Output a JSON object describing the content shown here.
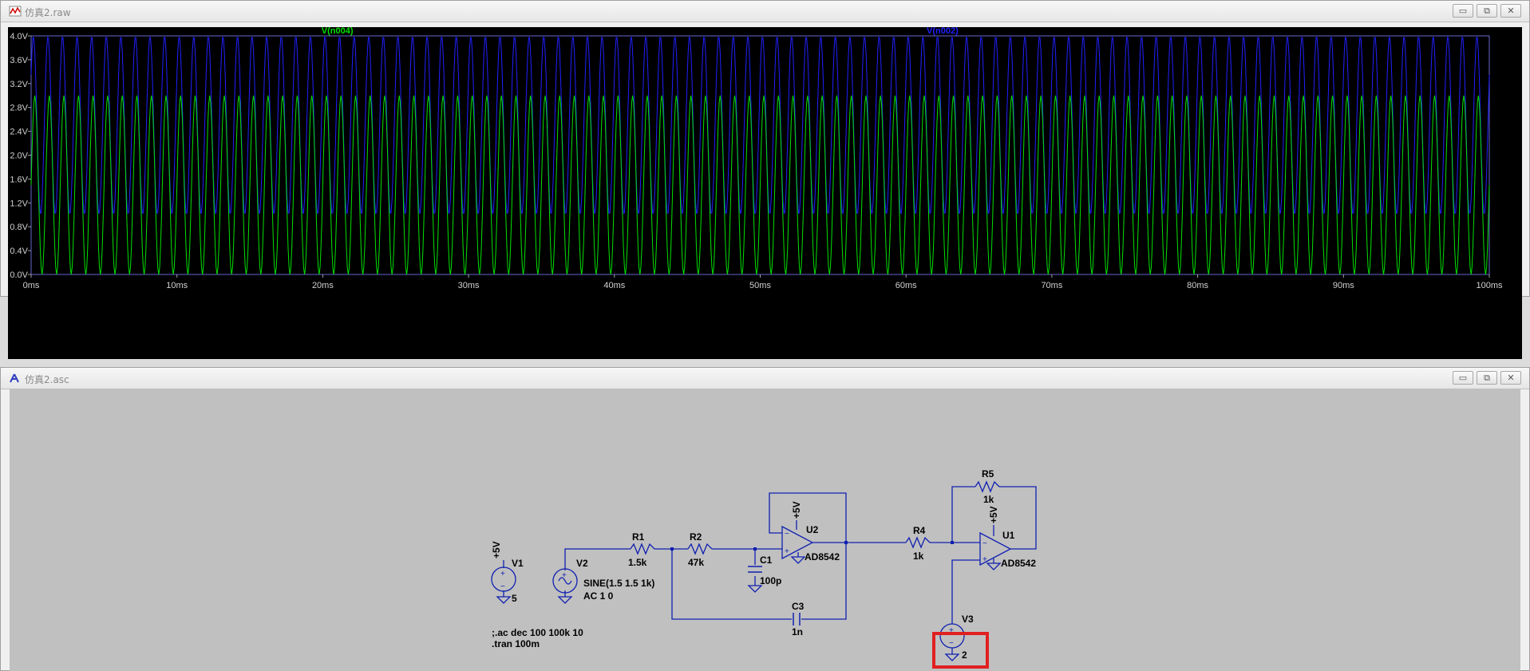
{
  "waveform_window": {
    "title": "仿真2.raw",
    "minimize_label": "▭",
    "restore_label": "⧉",
    "close_label": "✕",
    "traces": [
      {
        "name": "V(n004)",
        "color": "#00e000",
        "low_v": 0.0,
        "high_v": 3.0,
        "periods": 100
      },
      {
        "name": "V(n002)",
        "color": "#2020ff",
        "low_v": 1.0,
        "high_v": 4.0,
        "periods": 100
      }
    ],
    "y_ticks": [
      "4.0V",
      "3.6V",
      "3.2V",
      "2.8V",
      "2.4V",
      "2.0V",
      "1.6V",
      "1.2V",
      "0.8V",
      "0.4V",
      "0.0V"
    ],
    "x_ticks": [
      "0ms",
      "10ms",
      "20ms",
      "30ms",
      "40ms",
      "50ms",
      "60ms",
      "70ms",
      "80ms",
      "90ms",
      "100ms"
    ],
    "y_range": [
      0,
      4.0
    ],
    "x_range": [
      0,
      100
    ]
  },
  "schematic_window": {
    "title": "仿真2.asc",
    "minimize_label": "▭",
    "restore_label": "⧉",
    "close_label": "✕",
    "components": {
      "v1": {
        "name": "V1",
        "value": "5",
        "rail": "+5V"
      },
      "v2": {
        "name": "V2",
        "value": "SINE(1.5 1.5 1k)",
        "ac": "AC 1 0"
      },
      "v3": {
        "name": "V3",
        "value": "2"
      },
      "r1": {
        "name": "R1",
        "value": "1.5k"
      },
      "r2": {
        "name": "R2",
        "value": "47k"
      },
      "r4": {
        "name": "R4",
        "value": "1k"
      },
      "r5": {
        "name": "R5",
        "value": "1k"
      },
      "c1": {
        "name": "C1",
        "value": "100p"
      },
      "c3": {
        "name": "C3",
        "value": "1n"
      },
      "u2": {
        "name": "U2",
        "model": "AD8542",
        "rail": "+5V"
      },
      "u1": {
        "name": "U1",
        "model": "AD8542",
        "rail": "+5V"
      }
    },
    "directives": [
      ";.ac dec 100 100k 10",
      ".tran 100m"
    ],
    "highlight_color": "#e02020"
  }
}
